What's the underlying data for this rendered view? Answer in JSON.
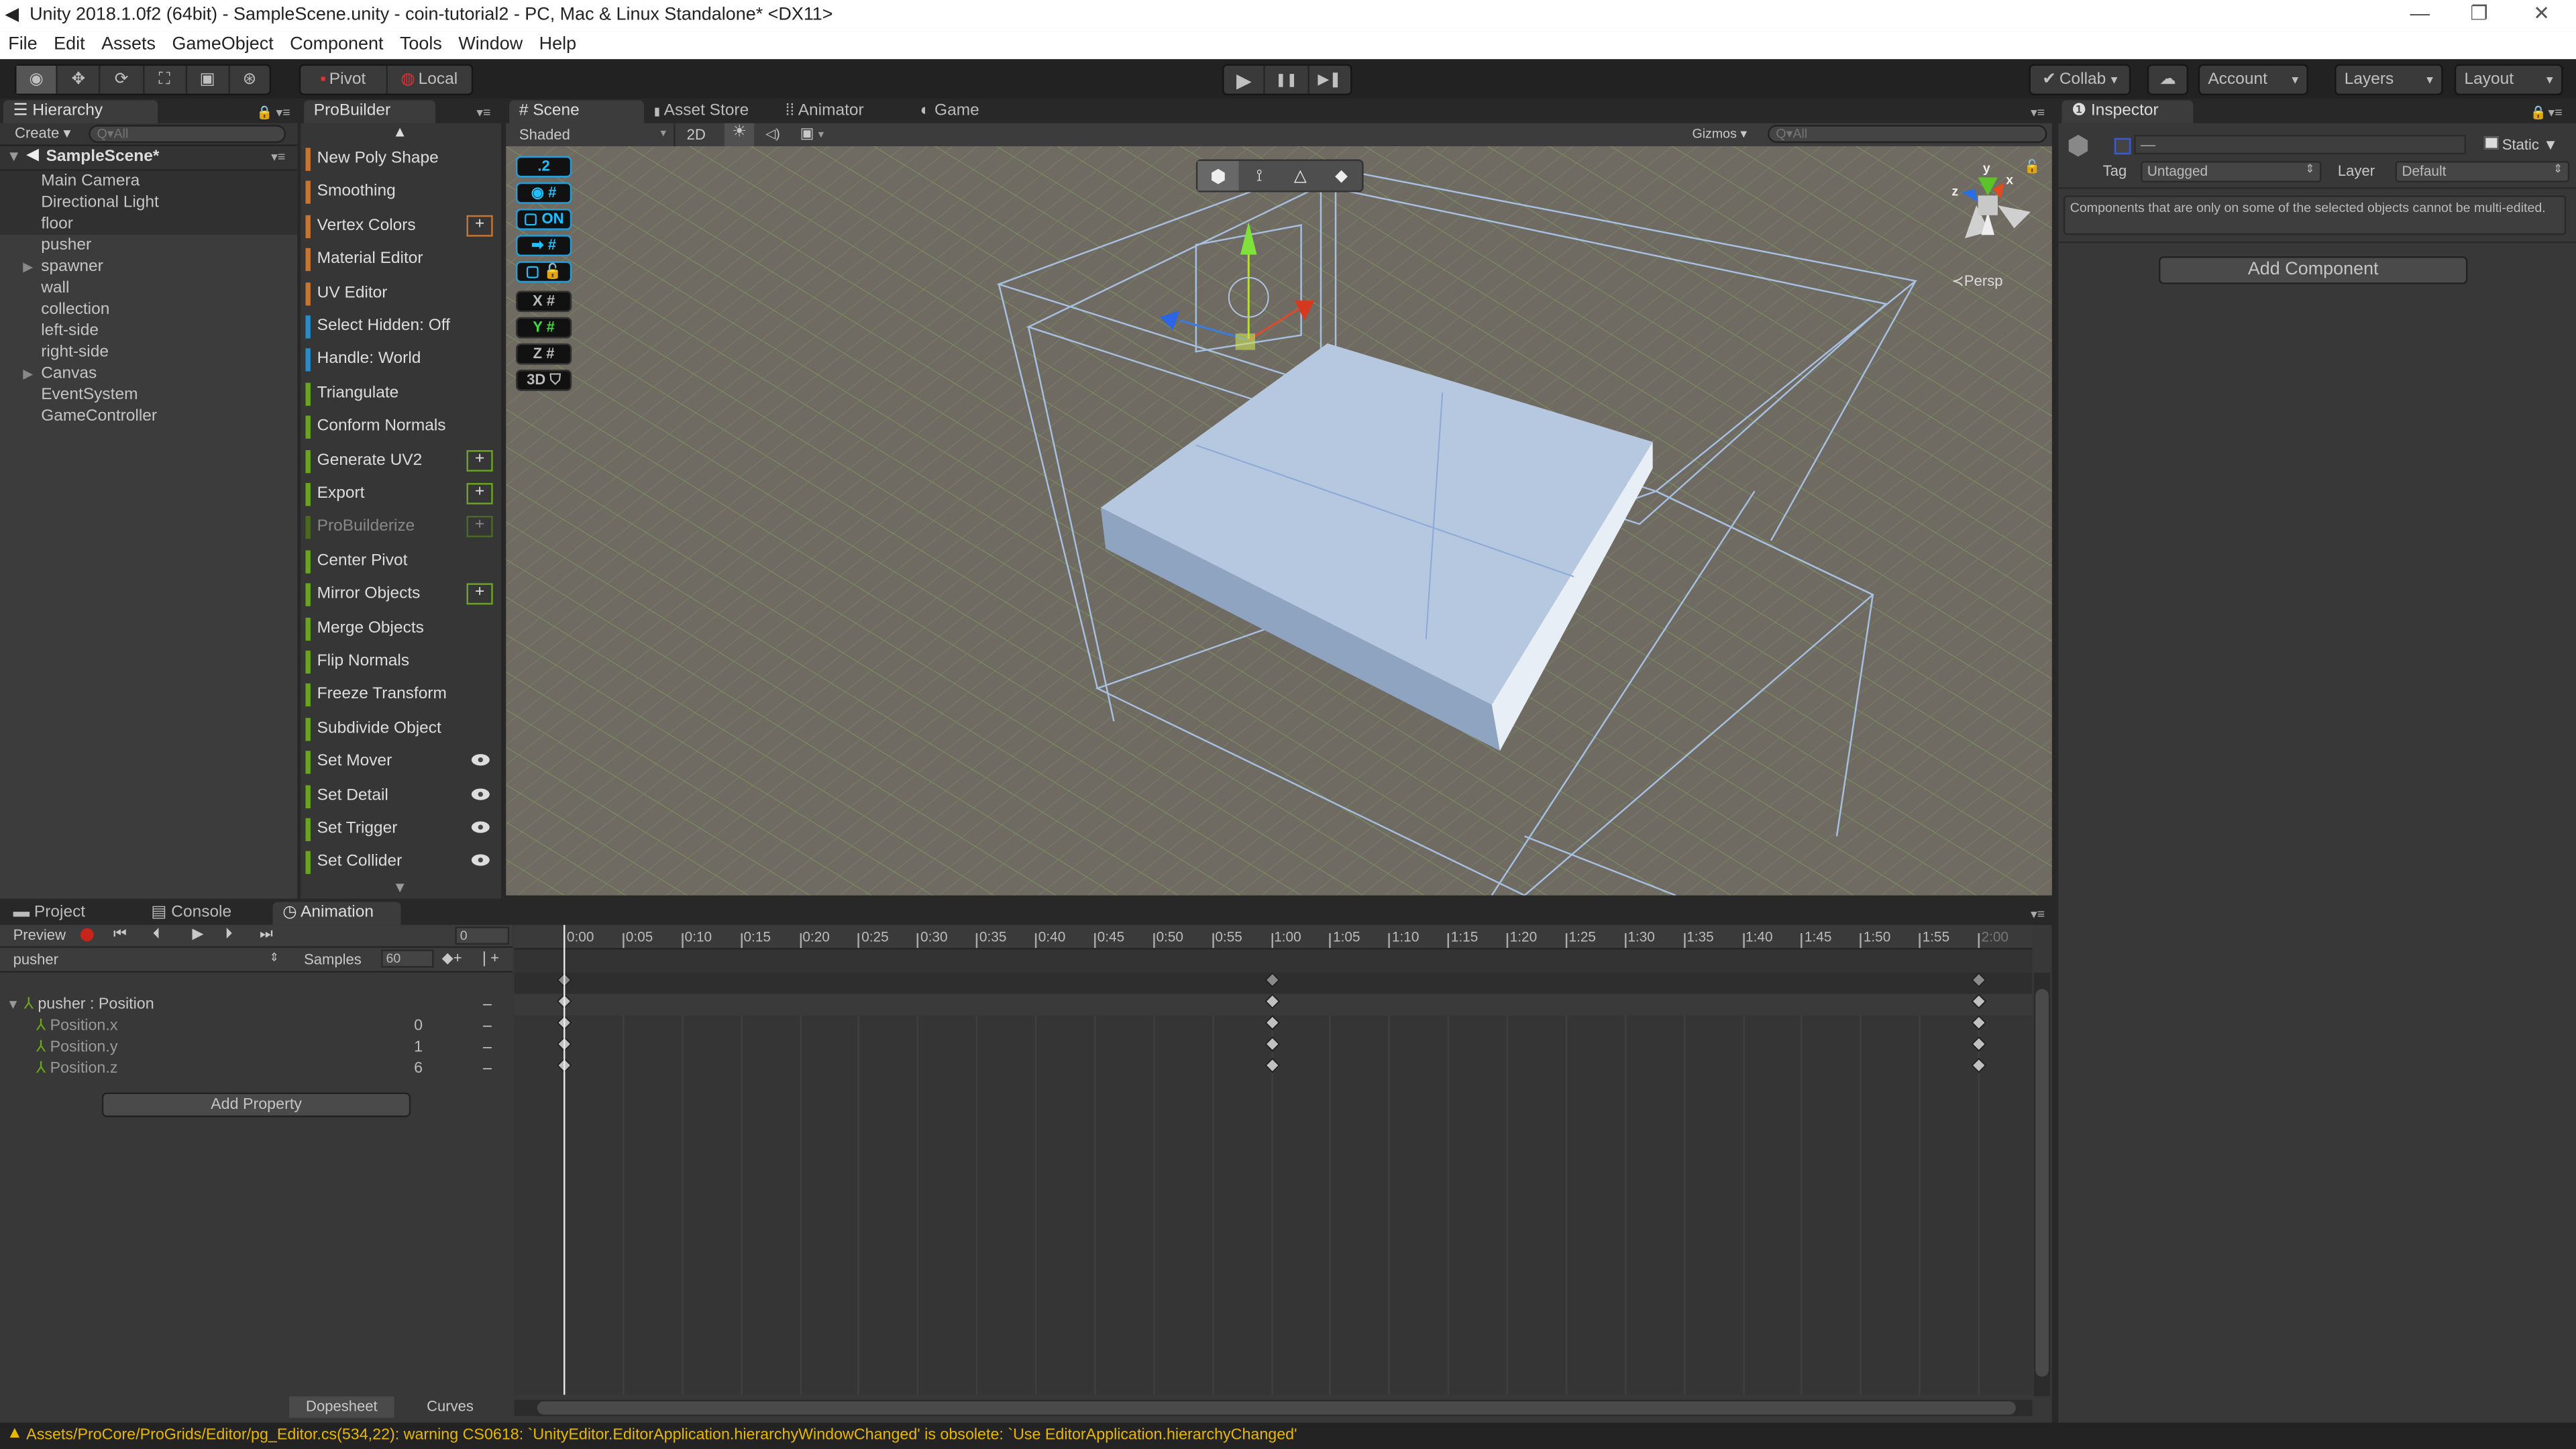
{
  "window": {
    "title": "Unity 2018.1.0f2 (64bit) - SampleScene.unity - coin-tutorial2 - PC, Mac & Linux Standalone* <DX11>",
    "minimize_glyph": "—",
    "restore_glyph": "❐",
    "close_glyph": "✕"
  },
  "menu": [
    "File",
    "Edit",
    "Assets",
    "GameObject",
    "Component",
    "Tools",
    "Window",
    "Help"
  ],
  "toolbar": {
    "tools": [
      {
        "name": "view-tool",
        "glyph": "◉"
      },
      {
        "name": "move-tool",
        "glyph": "✥"
      },
      {
        "name": "rotate-tool",
        "glyph": "⟳"
      },
      {
        "name": "scale-tool",
        "glyph": "⛶"
      },
      {
        "name": "rect-tool",
        "glyph": "▣"
      },
      {
        "name": "transform-tool",
        "glyph": "⊛"
      }
    ],
    "pivot_label": "Pivot",
    "local_label": "Local",
    "play_glyph": "▶",
    "pause_glyph": "❚❚",
    "step_glyph": "▶❚",
    "collab_label": "Collab",
    "cloud_glyph": "☁",
    "account_label": "Account",
    "layers_label": "Layers",
    "layout_label": "Layout",
    "dropdown_glyph": "▾"
  },
  "hierarchy": {
    "tab_label": "Hierarchy",
    "create_label": "Create",
    "search_placeholder": "Q▾All",
    "scene_name": "SampleScene*",
    "items": [
      {
        "label": "Main Camera",
        "expandable": false,
        "selected": true
      },
      {
        "label": "Directional Light",
        "expandable": false,
        "selected": true
      },
      {
        "label": "floor",
        "expandable": false,
        "selected": true
      },
      {
        "label": "pusher",
        "expandable": false,
        "selected": false
      },
      {
        "label": "spawner",
        "expandable": true,
        "selected": false
      },
      {
        "label": "wall",
        "expandable": false,
        "selected": false
      },
      {
        "label": "collection",
        "expandable": false,
        "selected": false
      },
      {
        "label": "left-side",
        "expandable": false,
        "selected": false
      },
      {
        "label": "right-side",
        "expandable": false,
        "selected": false
      },
      {
        "label": "Canvas",
        "expandable": true,
        "selected": false
      },
      {
        "label": "EventSystem",
        "expandable": false,
        "selected": false
      },
      {
        "label": "GameController",
        "expandable": false,
        "selected": false
      }
    ]
  },
  "probuilder": {
    "tab_label": "ProBuilder",
    "colors": {
      "orange": "#c87533",
      "blue": "#2a8cc4",
      "green": "#6aa51e",
      "green_dim": "#4a6a22"
    },
    "items": [
      {
        "label": "New Poly Shape",
        "color": "orange",
        "extra": ""
      },
      {
        "label": "Smoothing",
        "color": "orange",
        "extra": ""
      },
      {
        "label": "Vertex Colors",
        "color": "orange",
        "extra": "plus"
      },
      {
        "label": "Material Editor",
        "color": "orange",
        "extra": ""
      },
      {
        "label": "UV Editor",
        "color": "orange",
        "extra": ""
      },
      {
        "label": "Select Hidden: Off",
        "color": "blue",
        "extra": ""
      },
      {
        "label": "Handle: World",
        "color": "blue",
        "extra": ""
      },
      {
        "label": "Triangulate",
        "color": "green",
        "extra": ""
      },
      {
        "label": "Conform Normals",
        "color": "green",
        "extra": ""
      },
      {
        "label": "Generate UV2",
        "color": "green",
        "extra": "plus"
      },
      {
        "label": "Export",
        "color": "green",
        "extra": "plus"
      },
      {
        "label": "ProBuilderize",
        "color": "green_dim",
        "extra": "plus",
        "disabled": true
      },
      {
        "label": "Center Pivot",
        "color": "green",
        "extra": ""
      },
      {
        "label": "Mirror Objects",
        "color": "green",
        "extra": "plus"
      },
      {
        "label": "Merge Objects",
        "color": "green",
        "extra": ""
      },
      {
        "label": "Flip Normals",
        "color": "green",
        "extra": ""
      },
      {
        "label": "Freeze Transform",
        "color": "green",
        "extra": ""
      },
      {
        "label": "Subdivide Object",
        "color": "green",
        "extra": ""
      },
      {
        "label": "Set Mover",
        "color": "green",
        "extra": "eye"
      },
      {
        "label": "Set Detail",
        "color": "green",
        "extra": "eye"
      },
      {
        "label": "Set Trigger",
        "color": "green",
        "extra": "eye"
      },
      {
        "label": "Set Collider",
        "color": "green",
        "extra": "eye"
      }
    ],
    "scroll_up_glyph": "▲",
    "scroll_down_glyph": "▼",
    "plus_glyph": "+"
  },
  "scene": {
    "tabs": [
      {
        "label": "Scene",
        "glyph": "#",
        "active": true
      },
      {
        "label": "Asset Store",
        "glyph": "🔒",
        "active": false
      },
      {
        "label": "Animator",
        "glyph": "⁞⁞",
        "active": false
      },
      {
        "label": "Game",
        "glyph": "◐",
        "active": false
      }
    ],
    "shading_mode": "Shaded",
    "mode_2d": "2D",
    "lighting_glyph": "☀",
    "audio_glyph": "◁)",
    "effects_glyph": "▣",
    "gizmos_label": "Gizmos",
    "search_placeholder": "Q▾All",
    "progrids": [
      {
        "label": ".2",
        "active": true
      },
      {
        "label": "◉ #",
        "active": true
      },
      {
        "label": "▢ ON",
        "active": true
      },
      {
        "label": "➡ #",
        "active": true
      },
      {
        "label": "▢ 🔓",
        "active": true
      },
      {
        "label": "X #",
        "active": false
      },
      {
        "label": "Y #",
        "active": false,
        "color": "#3ddc3d"
      },
      {
        "label": "Z #",
        "active": false
      },
      {
        "label": "3D ⛉",
        "active": false
      }
    ],
    "selection_modes": [
      "object",
      "vertex",
      "edge",
      "face"
    ],
    "projection_label": "Persp",
    "axis_labels": {
      "x": "x",
      "y": "y",
      "z": "z"
    }
  },
  "inspector": {
    "tab_label": "Inspector",
    "name_value": "—",
    "static_label": "Static",
    "tag_label": "Tag",
    "tag_value": "Untagged",
    "layer_label": "Layer",
    "layer_value": "Default",
    "message": "Components that are only on some of the selected objects cannot be multi-edited.",
    "add_component_label": "Add Component"
  },
  "bottom_tabs": [
    {
      "label": "Project",
      "active": false
    },
    {
      "label": "Console",
      "active": false
    },
    {
      "label": "Animation",
      "active": true
    }
  ],
  "animation": {
    "preview_label": "Preview",
    "frame_value": "0",
    "clip_name": "pusher",
    "samples_label": "Samples",
    "samples_value": "60",
    "add_keyframe_glyph": "◆+",
    "add_event_glyph": "❘+",
    "property_group": "pusher : Position",
    "properties": [
      {
        "label": "Position.x",
        "value": "0"
      },
      {
        "label": "Position.y",
        "value": "1"
      },
      {
        "label": "Position.z",
        "value": "6"
      }
    ],
    "add_property_label": "Add Property",
    "dopesheet_label": "Dopesheet",
    "curves_label": "Curves",
    "ruler_labels": [
      "0:00",
      "0:05",
      "0:10",
      "0:15",
      "0:20",
      "0:25",
      "0:30",
      "0:35",
      "0:40",
      "0:45",
      "0:50",
      "0:55",
      "1:00",
      "1:05",
      "1:10",
      "1:15",
      "1:20",
      "1:25",
      "1:30",
      "1:35",
      "1:40",
      "1:45",
      "1:50",
      "1:55",
      "2:00"
    ],
    "keyframe_times": [
      "0:00",
      "1:00",
      "2:00"
    ],
    "current_time": "0:00"
  },
  "status": {
    "warning_glyph": "▲",
    "message": "Assets/ProCore/ProGrids/Editor/pg_Editor.cs(534,22): warning CS0618: `UnityEditor.EditorApplication.hierarchyWindowChanged' is obsolete: `Use EditorApplication.hierarchyChanged'"
  }
}
